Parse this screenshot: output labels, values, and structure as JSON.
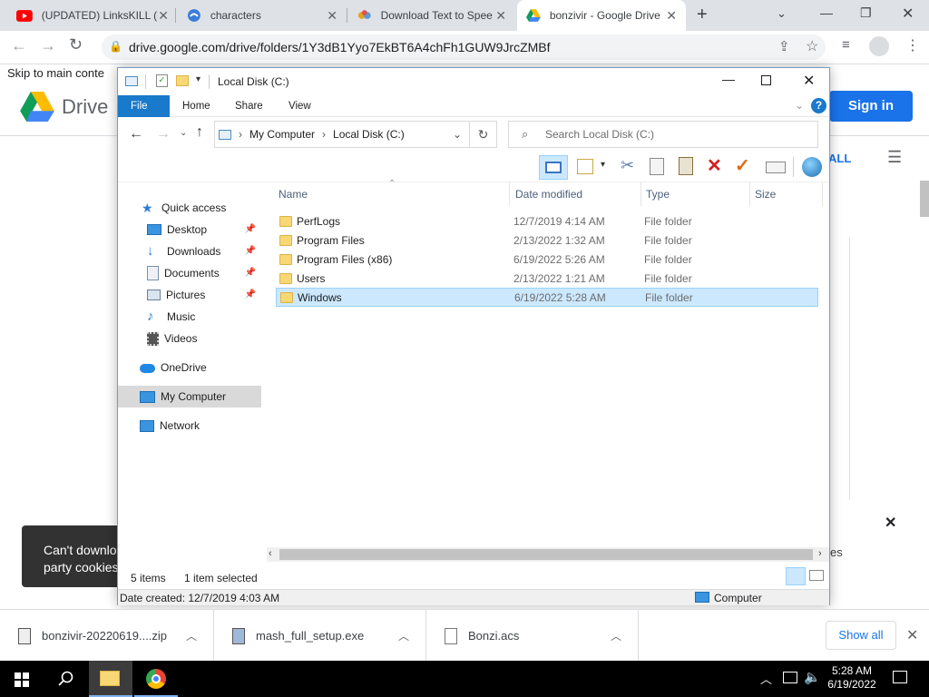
{
  "browser": {
    "tabs": [
      {
        "label": "(UPDATED) LinksKILL (l",
        "icon": "youtube-icon"
      },
      {
        "label": "characters",
        "icon": "webapp-icon"
      },
      {
        "label": "Download Text to Spee",
        "icon": "tts-icon"
      },
      {
        "label": "bonzivir - Google Drive",
        "icon": "google-drive-icon"
      }
    ],
    "new_tab": "+",
    "url": "drive.google.com/drive/folders/1Y3dB1Yyo7EkBT6A4chFh1GUW9JrcZMBf"
  },
  "drive": {
    "skip_link": "Skip to main conte",
    "logo_text": "Drive",
    "sign_in": "Sign in",
    "all_partial": "ALL",
    "toast_text": [
      "Can't downlo",
      "party cookies"
    ],
    "side_partial": "es"
  },
  "explorer": {
    "title": "Local Disk (C:)",
    "ribbon_tabs": [
      "File",
      "Home",
      "Share",
      "View"
    ],
    "breadcrumb": [
      "My Computer",
      "Local Disk (C:)"
    ],
    "search_placeholder": "Search Local Disk (C:)",
    "nav": {
      "quick_access": "Quick access",
      "pinned": [
        "Desktop",
        "Downloads",
        "Documents",
        "Pictures"
      ],
      "music": "Music",
      "videos": "Videos",
      "onedrive": "OneDrive",
      "my_computer": "My Computer",
      "network": "Network"
    },
    "columns": {
      "name": "Name",
      "date": "Date modified",
      "type": "Type",
      "size": "Size"
    },
    "rows": [
      {
        "name": "PerfLogs",
        "date": "12/7/2019 4:14 AM",
        "type": "File folder"
      },
      {
        "name": "Program Files",
        "date": "2/13/2022 1:32 AM",
        "type": "File folder"
      },
      {
        "name": "Program Files (x86)",
        "date": "6/19/2022 5:26 AM",
        "type": "File folder"
      },
      {
        "name": "Users",
        "date": "2/13/2022 1:21 AM",
        "type": "File folder"
      },
      {
        "name": "Windows",
        "date": "6/19/2022 5:28 AM",
        "type": "File folder"
      }
    ],
    "item_count": "5 items",
    "selected_count": "1 item selected",
    "details": "Date created: 12/7/2019 4:03 AM",
    "details_location": "Computer"
  },
  "downloads": {
    "items": [
      "bonzivir-20220619....zip",
      "mash_full_setup.exe",
      "Bonzi.acs"
    ],
    "show_all": "Show all"
  },
  "taskbar": {
    "time": "5:28 AM",
    "date": "6/19/2022"
  },
  "colors": {
    "ribbon_file": "#1979ca",
    "selection": "#cce8ff",
    "drive_sign_in": "#1a73e8"
  }
}
